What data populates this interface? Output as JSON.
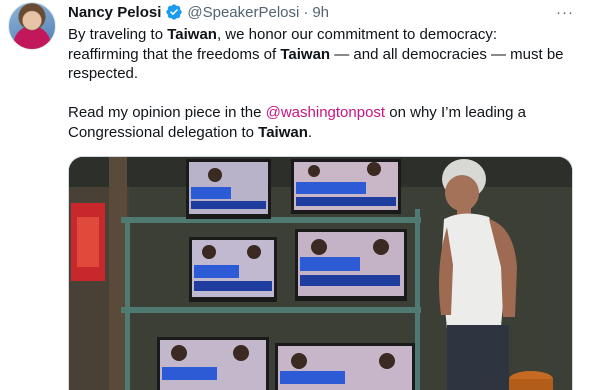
{
  "tweet": {
    "author_name": "Nancy Pelosi",
    "handle": "@SpeakerPelosi",
    "separator": "·",
    "time": "9h",
    "more_label": "···",
    "line1_a": "By traveling to ",
    "line1_b": "Taiwan",
    "line1_c": ", we honor our commitment to democracy:",
    "line2_a": "reaffirming that the freedoms of ",
    "line2_b": "Taiwan",
    "line2_c": " — and all democracies — must be",
    "line3": "respected.",
    "line4_a": "Read my opinion piece in the ",
    "line4_mention": "@washingtonpost",
    "line4_b": " on why I’m leading a",
    "line5_a": "Congressional delegation to ",
    "line5_b": "Taiwan",
    "line5_c": "."
  },
  "colors": {
    "text": "#0f1419",
    "secondary": "#536471",
    "mention": "#c71585",
    "verified": "#1d9bf0"
  },
  "icons": {
    "verified": "verified-badge-icon",
    "more": "more-options-icon"
  }
}
